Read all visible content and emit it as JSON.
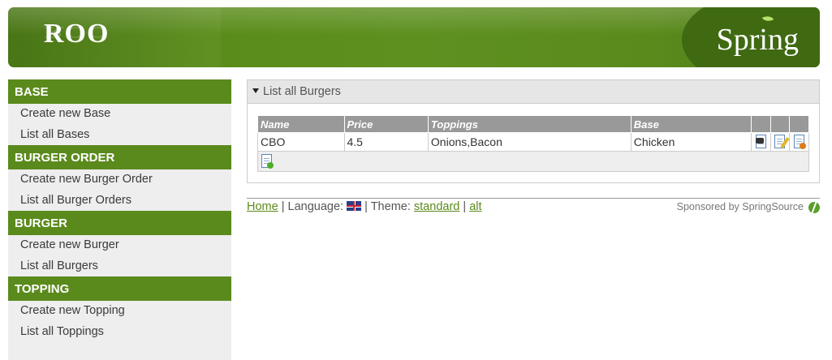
{
  "header": {
    "app_logo": "ROO",
    "brand_logo": "Spring"
  },
  "sidebar": {
    "categories": [
      {
        "title": "BASE",
        "items": [
          "Create new Base",
          "List all Bases"
        ]
      },
      {
        "title": "BURGER ORDER",
        "items": [
          "Create new Burger Order",
          "List all Burger Orders"
        ]
      },
      {
        "title": "BURGER",
        "items": [
          "Create new Burger",
          "List all Burgers"
        ]
      },
      {
        "title": "TOPPING",
        "items": [
          "Create new Topping",
          "List all Toppings"
        ]
      }
    ]
  },
  "main": {
    "panel_title": "List all Burgers",
    "table": {
      "columns": [
        "Name",
        "Price",
        "Toppings",
        "Base"
      ],
      "rows": [
        {
          "name": "CBO",
          "price": "4.5",
          "toppings": "Onions,Bacon",
          "base": "Chicken"
        }
      ]
    },
    "icons": {
      "show": "show-icon",
      "update": "update-icon",
      "delete": "delete-icon",
      "create": "create-icon"
    }
  },
  "footer": {
    "home_link": "Home",
    "sep1": "|",
    "language_label": "Language:",
    "sep2": "|",
    "theme_label": "Theme:",
    "theme_standard": "standard",
    "sep3": "|",
    "theme_alt": "alt",
    "sponsor_text": "Sponsored by SpringSource"
  },
  "colors": {
    "brand_green": "#5a8a1c",
    "table_header": "#999999",
    "sidebar_bg": "#eeeeee"
  }
}
